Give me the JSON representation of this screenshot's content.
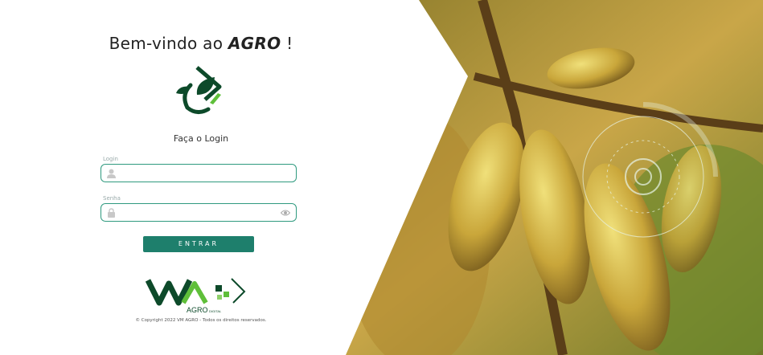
{
  "header": {
    "title_prefix": "Bem-vindo ao ",
    "title_brand": "AGRO",
    "title_suffix": " !"
  },
  "form": {
    "heading": "Faça o Login",
    "login_label": "Login",
    "login_value": "",
    "password_label": "Senha",
    "password_value": "",
    "submit_label": "ENTRAR"
  },
  "branding": {
    "bottom_logo_text": "AGRO",
    "bottom_logo_subtext": "DIGITAL",
    "copyright": "© Copyright 2022 VM AGRO - Todos os direitos reservados."
  },
  "icons": [
    "leaf-logo-icon",
    "user-icon",
    "lock-icon",
    "eye-icon",
    "vm-agro-logo"
  ],
  "colors": {
    "accent": "#1e7f6c",
    "border": "#2f9a7f",
    "logo_dark": "#0d4a2a",
    "logo_light": "#5fbf3a"
  }
}
